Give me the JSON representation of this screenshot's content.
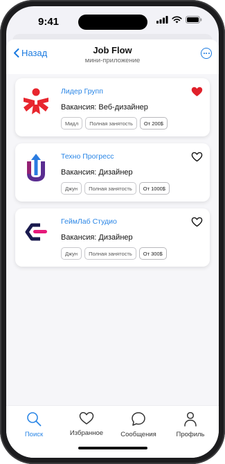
{
  "status": {
    "time": "9:41"
  },
  "header": {
    "back_label": "Назад",
    "title": "Job Flow",
    "subtitle": "мини-приложение"
  },
  "jobs": [
    {
      "company": "Лидер Групп",
      "vacancy": "Вакансия: Веб-дизайнер",
      "tags": [
        "Мидл",
        "Полная занятость",
        "От 200$"
      ],
      "favorite": true,
      "logo": "lider-logo-icon"
    },
    {
      "company": "Техно Прогресс",
      "vacancy": "Вакансия: Дизайнер",
      "tags": [
        "Джун",
        "Полная занятость",
        "От 1000$"
      ],
      "favorite": false,
      "logo": "techno-logo-icon"
    },
    {
      "company": "ГеймЛаб Студио",
      "vacancy": "Вакансия: Дизайнер",
      "tags": [
        "Джун",
        "Полная занятость",
        "От 300$"
      ],
      "favorite": false,
      "logo": "gamelab-logo-icon"
    }
  ],
  "tabs": [
    {
      "label": "Поиск",
      "icon": "search-icon",
      "active": true
    },
    {
      "label": "Избранное",
      "icon": "heart-icon",
      "active": false
    },
    {
      "label": "Сообщения",
      "icon": "chat-icon",
      "active": false
    },
    {
      "label": "Профиль",
      "icon": "person-icon",
      "active": false
    }
  ],
  "colors": {
    "accent": "#2a86e6",
    "favorite": "#e0202a",
    "logo_red": "#e8262e",
    "logo_purple": "#5a2d91",
    "logo_navy": "#1a1a4e",
    "logo_pink": "#e6197a"
  }
}
